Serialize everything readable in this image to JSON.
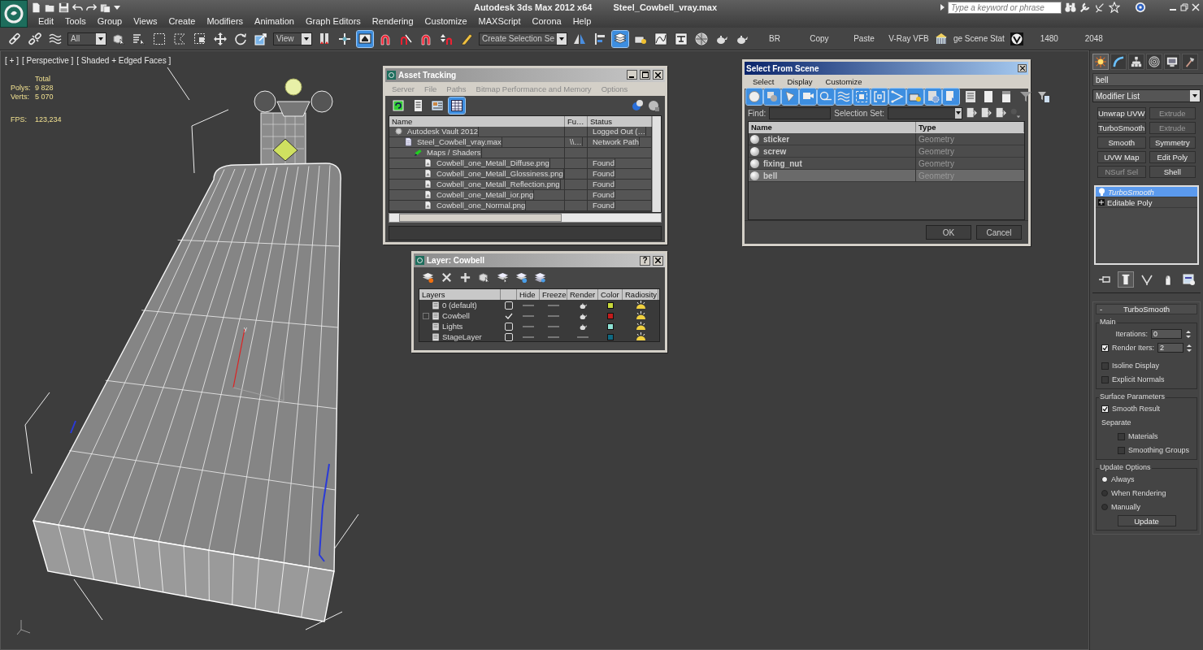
{
  "title_bar": {
    "app_title": "Autodesk 3ds Max  2012 x64",
    "file_name": "Steel_Cowbell_vray.max",
    "search": {
      "placeholder": "Type a keyword or phrase"
    }
  },
  "menu_bar": [
    "Edit",
    "Tools",
    "Group",
    "Views",
    "Create",
    "Modifiers",
    "Animation",
    "Graph Editors",
    "Rendering",
    "Customize",
    "MAXScript",
    "Corona",
    "Help"
  ],
  "main_toolbar": [
    {
      "kind": "chain",
      "selected": false
    },
    {
      "kind": "broken-chain",
      "selected": false
    },
    {
      "kind": "waves",
      "selected": false
    },
    {
      "kind": "dropdown",
      "value": "All"
    },
    {
      "kind": "cube-cursor",
      "selected": false
    },
    {
      "kind": "list-cursor",
      "selected": false
    },
    {
      "kind": "dashed-square",
      "selected": false
    },
    {
      "kind": "dashed-lasso",
      "selected": false
    },
    {
      "kind": "dashed-window",
      "selected": false
    },
    {
      "kind": "move-arrows",
      "selected": false
    },
    {
      "kind": "rotate-arrow",
      "selected": false
    },
    {
      "kind": "scale-box",
      "selected": false
    },
    {
      "kind": "dropdown",
      "value": "View"
    },
    {
      "kind": "pivot",
      "selected": false
    },
    {
      "kind": "crosshair",
      "selected": false
    },
    {
      "kind": "keyboard",
      "selected": true
    },
    {
      "kind": "magnet",
      "selected": false
    },
    {
      "kind": "angle-magnet",
      "selected": false
    },
    {
      "kind": "magnet",
      "selected": false
    },
    {
      "kind": "spinner-magnet",
      "selected": false
    },
    {
      "kind": "pencil",
      "selected": false
    },
    {
      "kind": "dropdown",
      "value": "Create Selection Se"
    },
    {
      "kind": "mirror",
      "selected": false
    },
    {
      "kind": "align",
      "selected": false
    },
    {
      "kind": "layers",
      "selected": true
    },
    {
      "kind": "box-bulb",
      "selected": false
    },
    {
      "kind": "curve-graph",
      "selected": false
    },
    {
      "kind": "schematic",
      "selected": false
    },
    {
      "kind": "sphere-grid",
      "selected": false
    },
    {
      "kind": "teapot",
      "selected": false
    },
    {
      "kind": "teapot",
      "selected": false
    },
    {
      "kind": "text",
      "label": "BR"
    },
    {
      "kind": "text",
      "label": "Copy"
    },
    {
      "kind": "text",
      "label": "Paste"
    },
    {
      "kind": "text",
      "label": "V-Ray VFB"
    },
    {
      "kind": "building",
      "selected": false
    },
    {
      "kind": "text",
      "label": "ge Scene Stat"
    },
    {
      "kind": "round-badge",
      "selected": false
    },
    {
      "kind": "text",
      "label": "1480"
    },
    {
      "kind": "text",
      "label": "2048"
    }
  ],
  "viewport": {
    "labels": [
      "[ + ]",
      "[ Perspective ]",
      "[ Shaded + Edged Faces ]"
    ],
    "stats": {
      "heading": "Total",
      "rows": [
        {
          "label": "Polys:",
          "value": "9 828"
        },
        {
          "label": "Verts:",
          "value": "5 070"
        },
        {
          "label": "FPS:",
          "value": "123,234"
        }
      ]
    },
    "axis_label": "y"
  },
  "asset_tracking": {
    "title": "Asset Tracking",
    "menus": [
      "Server",
      "File",
      "Paths",
      "Bitmap Performance and Memory",
      "Options"
    ],
    "tools": [
      {
        "kind": "refresh",
        "selected": false
      },
      {
        "kind": "document",
        "selected": false
      },
      {
        "kind": "thumbnail",
        "selected": false
      },
      {
        "kind": "table",
        "selected": true
      }
    ],
    "columns": [
      "Name",
      "Fu…",
      "Status"
    ],
    "rows": [
      {
        "kind": "vault",
        "name": "Autodesk Vault 2012",
        "status": "Logged Out (…",
        "children": [
          {
            "kind": "file",
            "name": "Steel_Cowbell_vray.max",
            "full_path": "\\\\…",
            "status": "Network Path",
            "children": [
              {
                "kind": "folder",
                "name": "Maps / Shaders",
                "children": [
                  {
                    "kind": "image",
                    "name": "Cowbell_one_Metall_Diffuse.png",
                    "status": "Found"
                  },
                  {
                    "kind": "image",
                    "name": "Cowbell_one_Metall_Glossiness.png",
                    "status": "Found"
                  },
                  {
                    "kind": "image",
                    "name": "Cowbell_one_Metall_Reflection.png",
                    "status": "Found"
                  },
                  {
                    "kind": "image",
                    "name": "Cowbell_one_Metall_ior.png",
                    "status": "Found"
                  },
                  {
                    "kind": "image",
                    "name": "Cowbell_one_Normal.png",
                    "status": "Found"
                  }
                ]
              }
            ]
          }
        ]
      }
    ]
  },
  "layer_manager": {
    "title": "Layer: Cowbell",
    "help": "?",
    "tools": [
      {
        "kind": "layer-new"
      },
      {
        "kind": "x-mark"
      },
      {
        "kind": "plus"
      },
      {
        "kind": "cube-cursor"
      },
      {
        "kind": "layer-cursor"
      },
      {
        "kind": "layer-plus"
      },
      {
        "kind": "layer-stack"
      }
    ],
    "columns": [
      "Layers",
      "Hide",
      "Freeze",
      "Render",
      "Color",
      "Radiosity"
    ],
    "layers": [
      {
        "name": "0 (default)",
        "expandable": false,
        "current": false,
        "renderable": true,
        "color": "#c8d83a"
      },
      {
        "name": "Cowbell",
        "expandable": true,
        "current": true,
        "renderable": true,
        "color": "#c41c1c"
      },
      {
        "name": "Lights",
        "expandable": false,
        "current": false,
        "renderable": true,
        "color": "#8ee2d4"
      },
      {
        "name": "StageLayer",
        "expandable": false,
        "current": false,
        "renderable": false,
        "color": "#106a82"
      }
    ]
  },
  "select_from_scene": {
    "title": "Select From Scene",
    "menus": [
      "Select",
      "Display",
      "Customize"
    ],
    "filters": [
      {
        "kind": "sphere",
        "selected": true
      },
      {
        "kind": "shapes",
        "selected": true
      },
      {
        "kind": "spotlight",
        "selected": true
      },
      {
        "kind": "camera",
        "selected": true
      },
      {
        "kind": "tape",
        "selected": true
      },
      {
        "kind": "waves",
        "selected": true
      },
      {
        "kind": "group",
        "selected": true
      },
      {
        "kind": "bracket",
        "selected": true
      },
      {
        "kind": "bone",
        "selected": true
      },
      {
        "kind": "box-bulb",
        "selected": true
      },
      {
        "kind": "gear-doc",
        "selected": true
      },
      {
        "kind": "doc-arrow",
        "selected": true
      },
      {
        "kind": "list",
        "selected": false
      },
      {
        "kind": "blank-page",
        "selected": false
      },
      {
        "kind": "half-page",
        "selected": false
      },
      {
        "kind": "funnel",
        "selected": false
      },
      {
        "kind": "funnel-list",
        "selected": false
      }
    ],
    "find_label": "Find:",
    "selection_set_label": "Selection Set:",
    "columns": [
      "Name",
      "Type"
    ],
    "rows": [
      {
        "name": "sticker",
        "type": "Geometry",
        "selected": false
      },
      {
        "name": "screw",
        "type": "Geometry",
        "selected": false
      },
      {
        "name": "fixing_nut",
        "type": "Geometry",
        "selected": false
      },
      {
        "name": "bell",
        "type": "Geometry",
        "selected": true
      }
    ],
    "buttons": [
      "OK",
      "Cancel"
    ]
  },
  "command_panel": {
    "tabs": [
      {
        "kind": "sun",
        "selected": true
      },
      {
        "kind": "curve",
        "selected": false
      },
      {
        "kind": "hierarchy",
        "selected": false
      },
      {
        "kind": "disc",
        "selected": false
      },
      {
        "kind": "monitor",
        "selected": false
      },
      {
        "kind": "hammer",
        "selected": false
      }
    ],
    "object_name": "bell",
    "modifier_list": "Modifier List",
    "modifier_buttons": [
      {
        "label": "Unwrap UVW",
        "disabled": false
      },
      {
        "label": "Extrude",
        "disabled": true
      },
      {
        "label": "TurboSmooth",
        "disabled": false
      },
      {
        "label": "Extrude",
        "disabled": true
      },
      {
        "label": "Smooth",
        "disabled": false
      },
      {
        "label": "Symmetry",
        "disabled": false
      },
      {
        "label": "UVW Map",
        "disabled": false
      },
      {
        "label": "Edit Poly",
        "disabled": false
      },
      {
        "label": "NSurf Sel",
        "disabled": true
      },
      {
        "label": "Shell",
        "disabled": false
      }
    ],
    "stack": [
      {
        "kind": "modifier",
        "label": "TurboSmooth",
        "selected": true
      },
      {
        "kind": "base",
        "label": "Editable Poly",
        "selected": false
      }
    ],
    "stack_tools": [
      {
        "kind": "pin",
        "selected": false
      },
      {
        "kind": "pipe",
        "selected": true
      },
      {
        "kind": "fork",
        "selected": false
      },
      {
        "kind": "hand",
        "selected": false
      },
      {
        "kind": "config",
        "selected": false
      }
    ],
    "rollout": {
      "collapse": "-",
      "title": "TurboSmooth",
      "main": {
        "title": "Main",
        "iterations": {
          "label": "Iterations:",
          "value": "0"
        },
        "render_iters": {
          "label": "Render Iters:",
          "checked": true,
          "value": "2"
        },
        "checkboxes": [
          {
            "label": "Isoline Display",
            "checked": false
          },
          {
            "label": "Explicit Normals",
            "checked": false
          }
        ]
      },
      "surface": {
        "title": "Surface Parameters",
        "smooth_result": {
          "label": "Smooth Result",
          "checked": true
        },
        "separate_label": "Separate",
        "separate": [
          {
            "label": "Materials",
            "checked": false
          },
          {
            "label": "Smoothing Groups",
            "checked": false
          }
        ]
      },
      "update": {
        "title": "Update Options",
        "options": [
          {
            "label": "Always",
            "selected": true
          },
          {
            "label": "When Rendering",
            "selected": false
          },
          {
            "label": "Manually",
            "selected": false
          }
        ],
        "button": "Update"
      }
    }
  }
}
